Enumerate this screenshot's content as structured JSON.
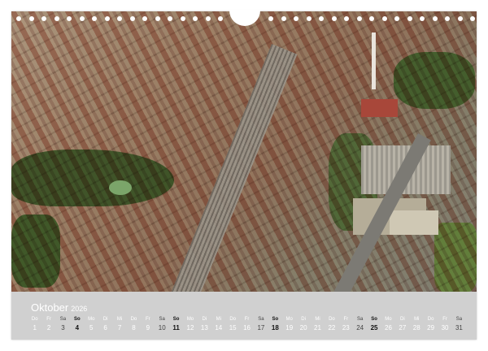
{
  "calendar": {
    "month": "Oktober",
    "year": "2026",
    "days": [
      {
        "dow": "Do",
        "num": "1",
        "kind": "wd"
      },
      {
        "dow": "Fr",
        "num": "2",
        "kind": "wd"
      },
      {
        "dow": "Sa",
        "num": "3",
        "kind": "sat"
      },
      {
        "dow": "So",
        "num": "4",
        "kind": "sun"
      },
      {
        "dow": "Mo",
        "num": "5",
        "kind": "wd"
      },
      {
        "dow": "Di",
        "num": "6",
        "kind": "wd"
      },
      {
        "dow": "Mi",
        "num": "7",
        "kind": "wd"
      },
      {
        "dow": "Do",
        "num": "8",
        "kind": "wd"
      },
      {
        "dow": "Fr",
        "num": "9",
        "kind": "wd"
      },
      {
        "dow": "Sa",
        "num": "10",
        "kind": "sat"
      },
      {
        "dow": "So",
        "num": "11",
        "kind": "sun"
      },
      {
        "dow": "Mo",
        "num": "12",
        "kind": "wd"
      },
      {
        "dow": "Di",
        "num": "13",
        "kind": "wd"
      },
      {
        "dow": "Mi",
        "num": "14",
        "kind": "wd"
      },
      {
        "dow": "Do",
        "num": "15",
        "kind": "wd"
      },
      {
        "dow": "Fr",
        "num": "16",
        "kind": "wd"
      },
      {
        "dow": "Sa",
        "num": "17",
        "kind": "sat"
      },
      {
        "dow": "So",
        "num": "18",
        "kind": "sun"
      },
      {
        "dow": "Mo",
        "num": "19",
        "kind": "wd"
      },
      {
        "dow": "Di",
        "num": "20",
        "kind": "wd"
      },
      {
        "dow": "Mi",
        "num": "21",
        "kind": "wd"
      },
      {
        "dow": "Do",
        "num": "22",
        "kind": "wd"
      },
      {
        "dow": "Fr",
        "num": "23",
        "kind": "wd"
      },
      {
        "dow": "Sa",
        "num": "24",
        "kind": "sat"
      },
      {
        "dow": "So",
        "num": "25",
        "kind": "sun"
      },
      {
        "dow": "Mo",
        "num": "26",
        "kind": "wd"
      },
      {
        "dow": "Di",
        "num": "27",
        "kind": "wd"
      },
      {
        "dow": "Mi",
        "num": "28",
        "kind": "wd"
      },
      {
        "dow": "Do",
        "num": "29",
        "kind": "wd"
      },
      {
        "dow": "Fr",
        "num": "30",
        "kind": "wd"
      },
      {
        "dow": "Sa",
        "num": "31",
        "kind": "sat"
      }
    ]
  },
  "colors": {
    "strip": "#d0d0d0",
    "text_light": "#ffffff",
    "sunday": "#111111"
  }
}
